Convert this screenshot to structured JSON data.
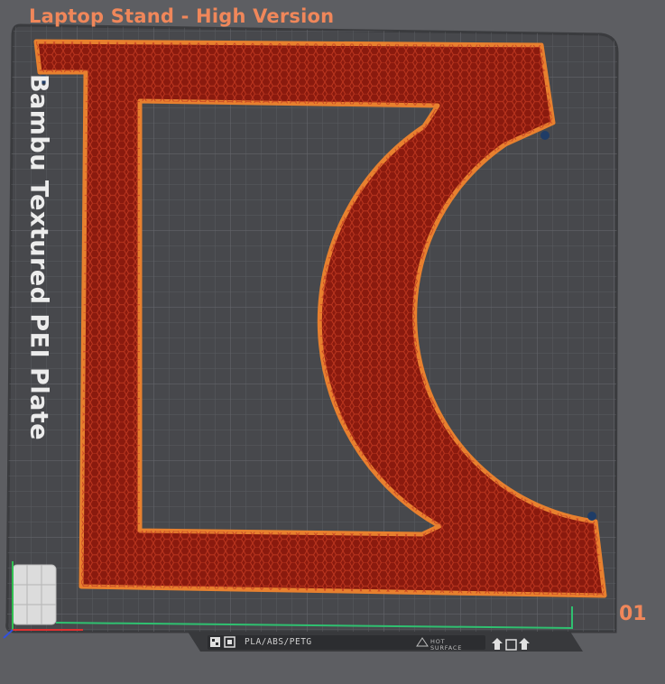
{
  "header": {
    "title": "Laptop Stand - High Version"
  },
  "plate": {
    "brand_label": "Bambu Textured PEI Plate",
    "number": "01",
    "material_badge": "PLA/ABS/PETG",
    "surface_warning": [
      "HOT",
      "SURFACE"
    ]
  },
  "colors": {
    "accent": "#f0875a",
    "background": "#5d5e62",
    "plate": "#46474b",
    "grid_line": "#5b5c60",
    "part_outline": "#e8802e",
    "part_infill": "#8a1a0e",
    "infill_mesh": "#c03a20",
    "axis_x": "#e03030",
    "axis_y": "#30c050",
    "axis_z": "#3050e0"
  },
  "icons": {
    "qr": "qr-code-icon",
    "hot_surface": "hot-surface-warning-icon",
    "orientation": "plate-orientation-icon"
  }
}
